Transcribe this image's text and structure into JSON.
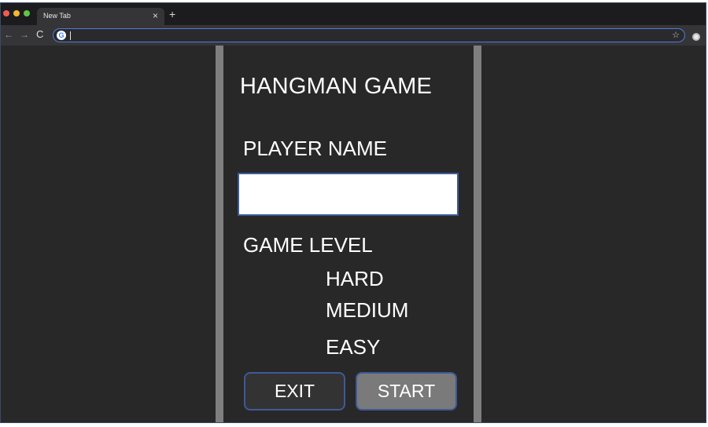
{
  "browser": {
    "tab_title": "New Tab",
    "tab_close": "×",
    "new_tab": "+",
    "back": "←",
    "forward": "→",
    "reload": "C",
    "address_value": "",
    "search_engine_letter": "G",
    "bookmark_star": "☆"
  },
  "game": {
    "title": "HANGMAN GAME",
    "player_label": "PLAYER NAME",
    "player_name_value": "",
    "level_label": "GAME LEVEL",
    "levels": [
      "HARD",
      "MEDIUM",
      "EASY"
    ],
    "exit_label": "EXIT",
    "start_label": "START"
  },
  "colors": {
    "background": "#282828",
    "pillar": "#7f7f7f",
    "button_border": "#3d5a99",
    "exit_bg": "#333333",
    "start_bg": "#7a7a7a"
  }
}
